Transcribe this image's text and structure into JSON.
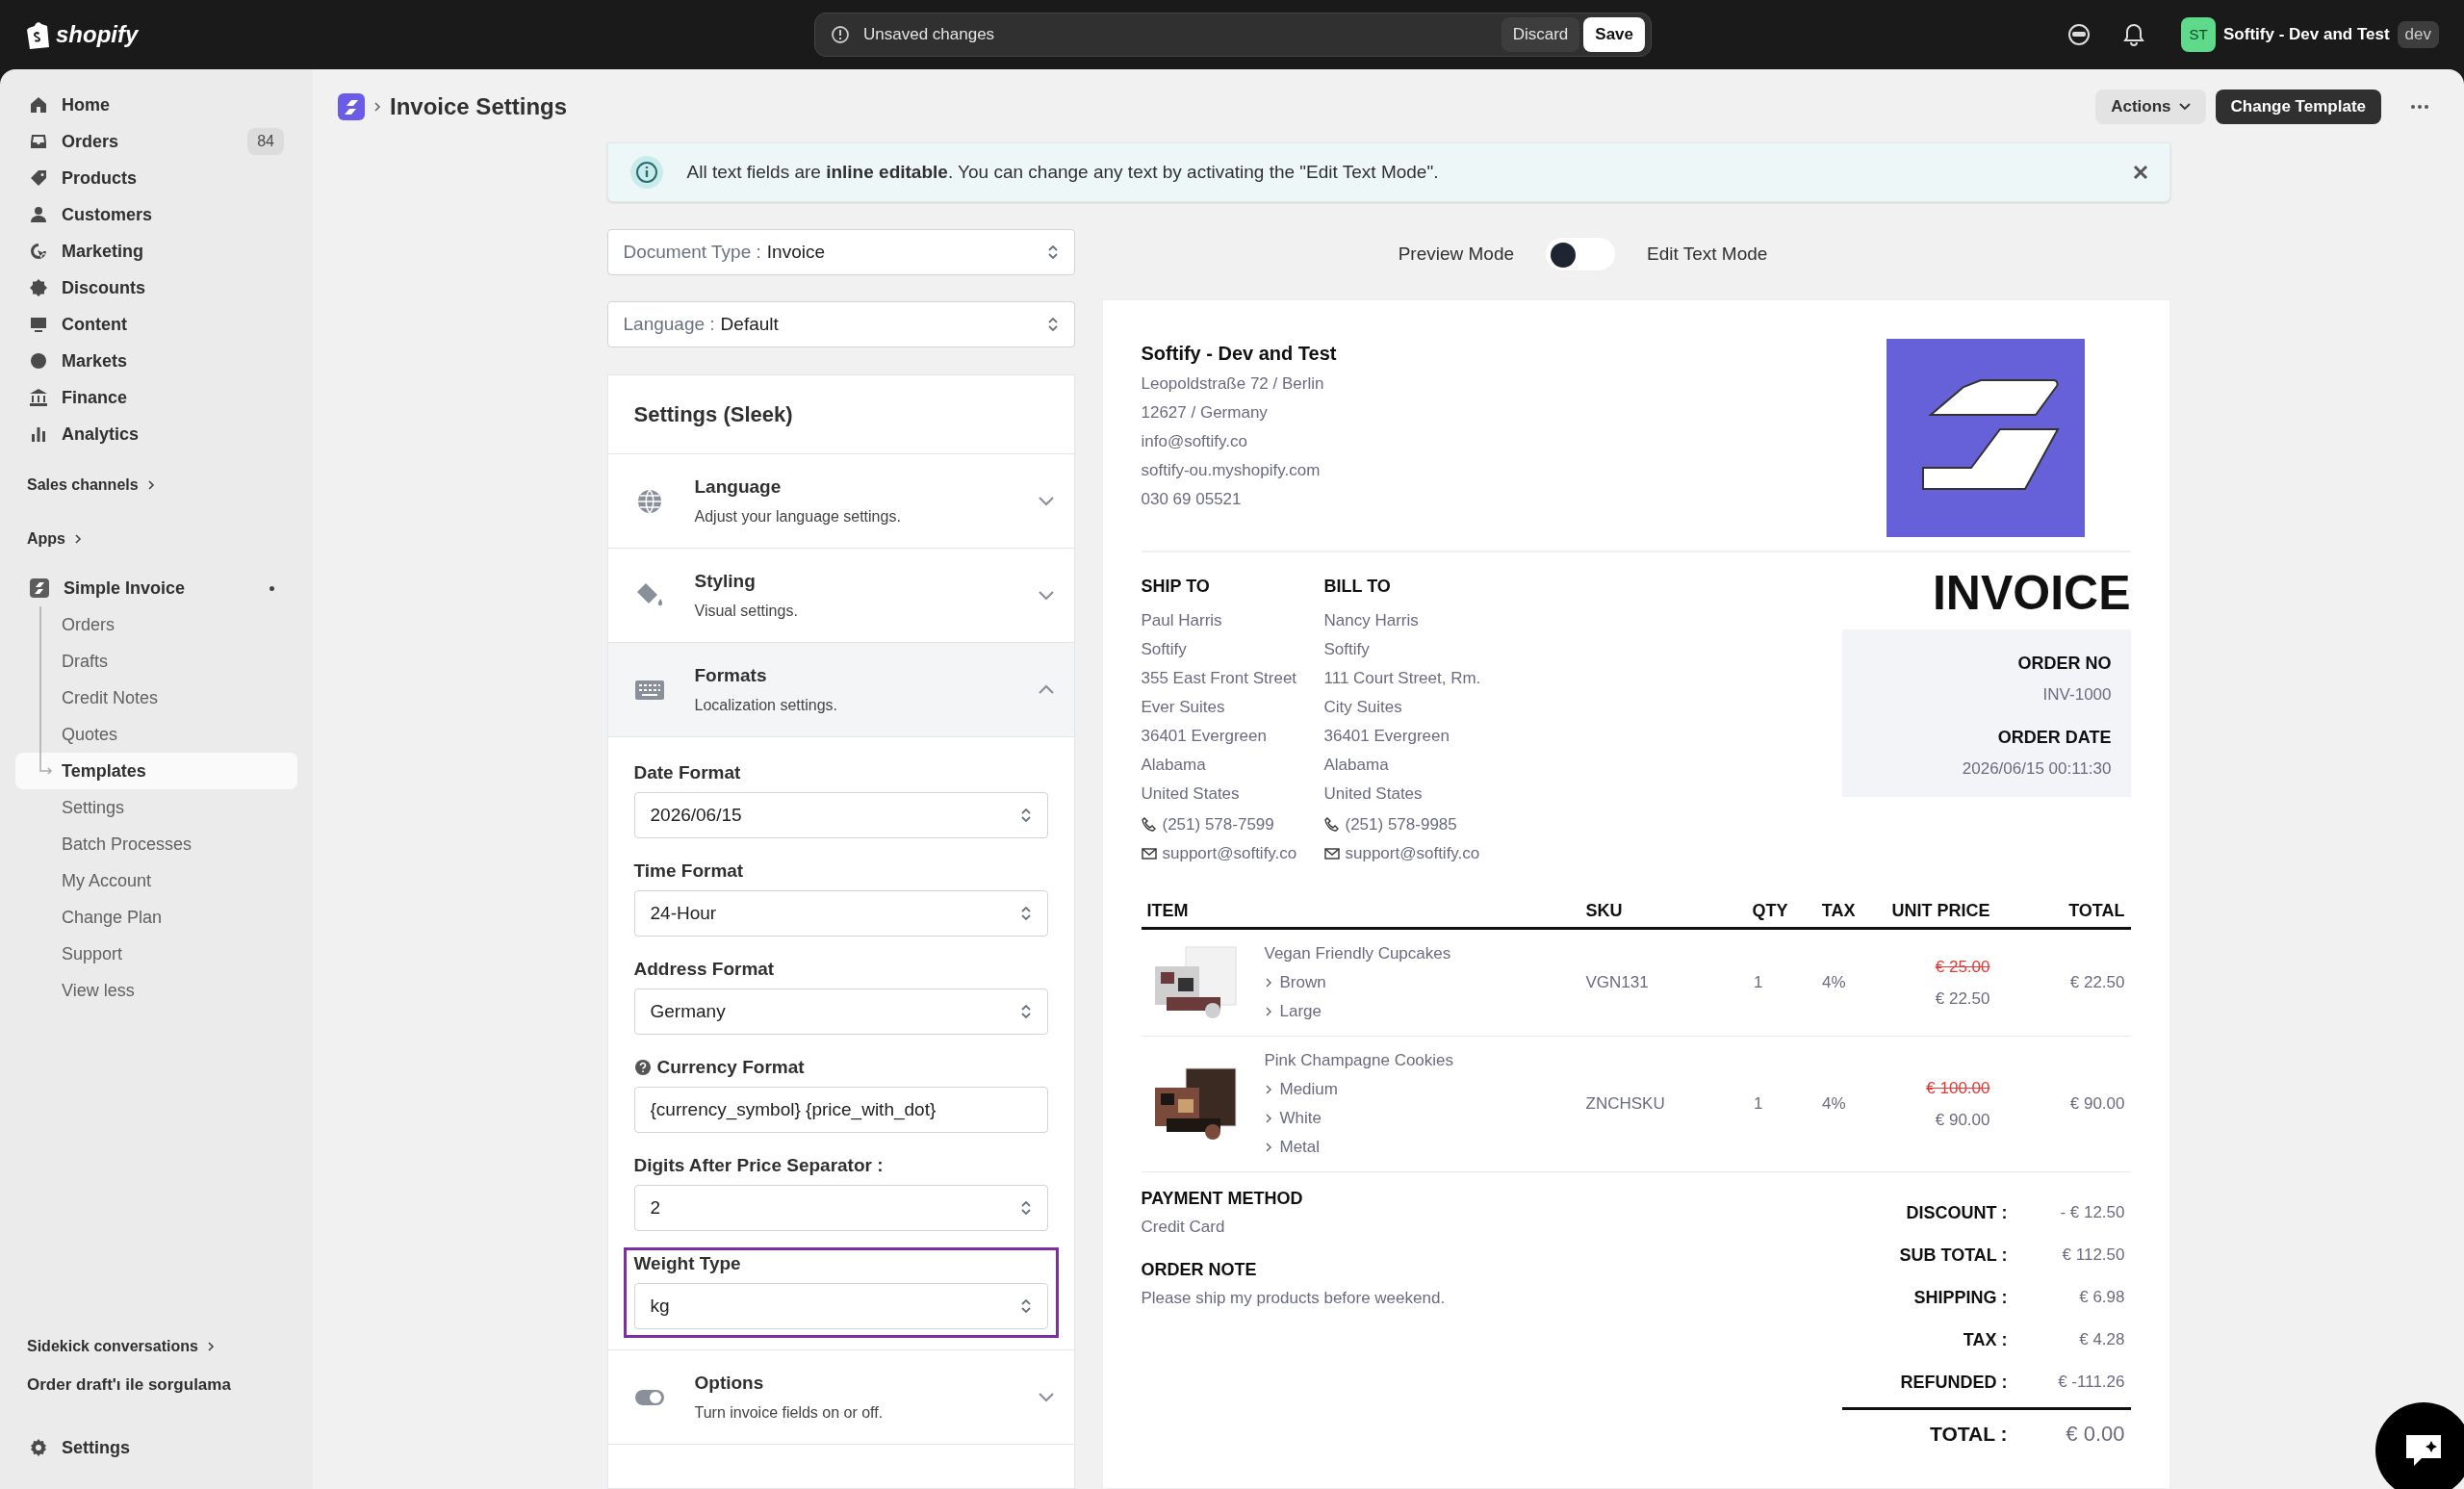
{
  "top_bar": {
    "logo_text": "shopify",
    "unsaved": {
      "message": "Unsaved changes",
      "discard": "Discard",
      "save": "Save"
    },
    "store": {
      "initials": "ST",
      "name": "Softify - Dev and Test",
      "badge": "dev"
    }
  },
  "sidebar": {
    "items": [
      {
        "label": "Home",
        "selected": false
      },
      {
        "label": "Orders",
        "count": "84",
        "selected": false
      },
      {
        "label": "Products",
        "selected": false
      },
      {
        "label": "Customers",
        "selected": false
      },
      {
        "label": "Marketing",
        "selected": false
      },
      {
        "label": "Discounts",
        "selected": false
      },
      {
        "label": "Content",
        "selected": false
      },
      {
        "label": "Markets",
        "selected": false
      },
      {
        "label": "Finance",
        "selected": false
      },
      {
        "label": "Analytics",
        "selected": false
      }
    ],
    "sales_channels": "Sales channels",
    "apps": "Apps",
    "app": {
      "name": "Simple Invoice",
      "notification": true,
      "items": [
        {
          "label": "Orders",
          "selected": false
        },
        {
          "label": "Drafts",
          "selected": false
        },
        {
          "label": "Credit Notes",
          "selected": false
        },
        {
          "label": "Quotes",
          "selected": false
        },
        {
          "label": "Templates",
          "selected": true
        },
        {
          "label": "Settings",
          "selected": false
        },
        {
          "label": "Batch Processes",
          "selected": false
        },
        {
          "label": "My Account",
          "selected": false
        },
        {
          "label": "Change Plan",
          "selected": false
        },
        {
          "label": "Support",
          "selected": false
        },
        {
          "label": "View less",
          "selected": false
        }
      ]
    },
    "sidekick": "Sidekick conversations",
    "recent": "Order draft'ı ile sorgulama",
    "settings": "Settings"
  },
  "page": {
    "title": "Invoice Settings",
    "actions": "Actions",
    "change_template": "Change Template"
  },
  "banner": {
    "text": "All text fields are **inline editable**. You can change any text by activating the \"Edit Text Mode\"."
  },
  "document_type": {
    "label": "Document Type :",
    "value": "Invoice"
  },
  "language": {
    "label": "Language :",
    "value": "Default"
  },
  "mode": {
    "preview_label": "Preview Mode",
    "edit_label": "Edit Text Mode",
    "edit_mode": false
  },
  "settings_panel": {
    "title": "Settings (Sleek)",
    "sections": [
      {
        "title": "Language",
        "subtitle": "Adjust your language settings.",
        "expanded": false
      },
      {
        "title": "Styling",
        "subtitle": "Visual settings.",
        "expanded": false
      },
      {
        "title": "Formats",
        "subtitle": "Localization settings.",
        "expanded": true,
        "fields": [
          {
            "label": "Date Format",
            "value": "2026/06/15",
            "kind": "select",
            "help": false,
            "highlighted": false
          },
          {
            "label": "Time Format",
            "value": "24-Hour",
            "kind": "select",
            "help": false,
            "highlighted": false
          },
          {
            "label": "Address Format",
            "value": "Germany",
            "kind": "select",
            "help": false,
            "highlighted": false
          },
          {
            "label": "Currency Format",
            "value": "{currency_symbol} {price_with_dot}",
            "kind": "input",
            "help": true,
            "highlighted": false
          },
          {
            "label": "Digits After Price Separator :",
            "value": "2",
            "kind": "select",
            "help": false,
            "highlighted": false
          },
          {
            "label": "Weight Type",
            "value": "kg",
            "kind": "select",
            "help": false,
            "highlighted": true
          }
        ]
      },
      {
        "title": "Options",
        "subtitle": "Turn invoice fields on or off.",
        "expanded": false
      }
    ]
  },
  "invoice": {
    "company": {
      "name": "Softify - Dev and Test",
      "lines": [
        "Leopoldstraße 72 / Berlin",
        "12627 / Germany",
        "info@softify.co",
        "softify-ou.myshopify.com",
        "030 69 05521"
      ]
    },
    "ship_to": {
      "heading": "SHIP TO",
      "lines": [
        "Paul Harris",
        "Softify",
        "355 East Front Street",
        "Ever Suites",
        "36401 Evergreen",
        "Alabama",
        "United States"
      ],
      "phone": "(251) 578-7599",
      "email": "support@softify.co"
    },
    "bill_to": {
      "heading": "BILL TO",
      "lines": [
        "Nancy Harris",
        "Softify",
        "111 Court Street, Rm.",
        "City Suites",
        "36401 Evergreen",
        "Alabama",
        "United States"
      ],
      "phone": "(251) 578-9985",
      "email": "support@softify.co"
    },
    "title": "INVOICE",
    "order_no": {
      "label": "ORDER NO",
      "value": "INV-1000"
    },
    "order_date": {
      "label": "ORDER DATE",
      "value": "2026/06/15 00:11:30"
    },
    "columns": [
      "ITEM",
      "SKU",
      "QTY",
      "TAX",
      "UNIT PRICE",
      "TOTAL"
    ],
    "rows": [
      {
        "name": "Vegan Friendly Cupcakes",
        "variants": [
          "Brown",
          "Large"
        ],
        "sku": "VGN131",
        "qty": "1",
        "tax": "4%",
        "old_price": "€ 25.00",
        "price": "€ 22.50",
        "total": "€ 22.50"
      },
      {
        "name": "Pink Champagne Cookies",
        "variants": [
          "Medium",
          "White",
          "Metal"
        ],
        "sku": "ZNCHSKU",
        "qty": "1",
        "tax": "4%",
        "old_price": "€ 100.00",
        "price": "€ 90.00",
        "total": "€ 90.00"
      }
    ],
    "payment": {
      "heading": "PAYMENT METHOD",
      "value": "Credit Card"
    },
    "note": {
      "heading": "ORDER NOTE",
      "value": "Please ship my products before weekend."
    },
    "totals": [
      {
        "label": "DISCOUNT :",
        "value": "- € 12.50"
      },
      {
        "label": "SUB TOTAL :",
        "value": "€ 112.50"
      },
      {
        "label": "SHIPPING :",
        "value": "€ 6.98"
      },
      {
        "label": "TAX :",
        "value": "€ 4.28"
      },
      {
        "label": "REFUNDED :",
        "value": "€ -111.26"
      }
    ],
    "grand_total": {
      "label": "TOTAL :",
      "value": "€ 0.00"
    }
  }
}
